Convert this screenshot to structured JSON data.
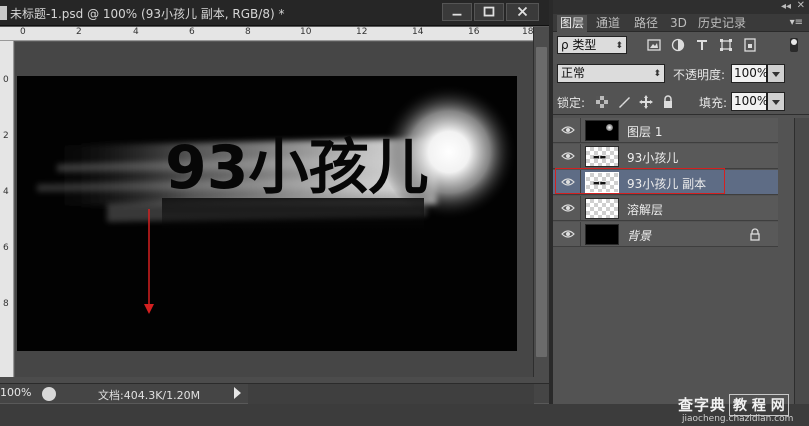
{
  "document": {
    "title": "未标题-1.psd @ 100% (93小孩儿 副本, RGB/8) *",
    "window_buttons": [
      "minimize-icon",
      "maximize-icon",
      "close-icon"
    ],
    "ruler_h_numbers": [
      "0",
      "2",
      "4",
      "6",
      "8",
      "10",
      "12",
      "14",
      "16",
      "18"
    ],
    "ruler_v_numbers": [
      "0",
      "2",
      "4",
      "6",
      "8"
    ],
    "canvas": {
      "text": "93小孩儿",
      "arrow_color": "#d42020"
    },
    "status": {
      "zoom": "100%",
      "doc_info": "文档:404.3K/1.20M"
    }
  },
  "panel": {
    "tabs": [
      "图层",
      "通道",
      "路径",
      "3D",
      "历史记录"
    ],
    "active_tab": "图层",
    "filter": {
      "type_label": "ρ 类型",
      "icons": [
        "image-filter-icon",
        "adjustment-filter-icon",
        "type-filter-icon",
        "shape-filter-icon",
        "smart-object-filter-icon"
      ]
    },
    "blend": {
      "mode": "正常",
      "opacity_label": "不透明度:",
      "opacity_value": "100%"
    },
    "lock": {
      "label": "锁定:",
      "fill_label": "填充:",
      "fill_value": "100%"
    },
    "layers": [
      {
        "name": "图层 1",
        "thumb": "black-glow",
        "selected": false,
        "locked": false
      },
      {
        "name": "93小孩儿",
        "thumb": "checker-text",
        "selected": false,
        "locked": false
      },
      {
        "name": "93小孩儿 副本",
        "thumb": "checker-text",
        "selected": true,
        "locked": false
      },
      {
        "name": "溶解层",
        "thumb": "checker",
        "selected": false,
        "locked": false
      },
      {
        "name": "背景",
        "thumb": "black",
        "selected": false,
        "locked": true
      }
    ],
    "highlight_color": "#d42020"
  },
  "watermark": {
    "main": "查字典",
    "boxed": "教 程 网",
    "url": "jiaocheng.chazidian.com"
  }
}
